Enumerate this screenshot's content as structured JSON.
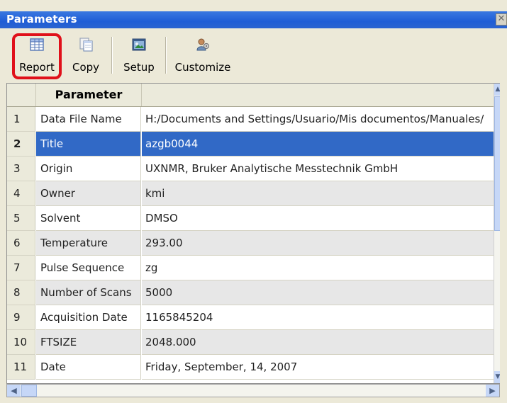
{
  "window": {
    "title": "Parameters",
    "close_glyph": "✕"
  },
  "toolbar": {
    "buttons": [
      {
        "label": "Report",
        "icon": "table-icon"
      },
      {
        "label": "Copy",
        "icon": "copy-icon"
      },
      {
        "label": "Setup",
        "icon": "setup-icon"
      },
      {
        "label": "Customize",
        "icon": "customize-icon"
      }
    ]
  },
  "table": {
    "header": {
      "parameter": "Parameter",
      "value": ""
    },
    "rows": [
      {
        "num": "1",
        "name": "Data File Name",
        "value": "H:/Documents and Settings/Usuario/Mis documentos/Manuales/"
      },
      {
        "num": "2",
        "name": "Title",
        "value": "azgb0044"
      },
      {
        "num": "3",
        "name": "Origin",
        "value": "UXNMR, Bruker Analytische Messtechnik GmbH"
      },
      {
        "num": "4",
        "name": "Owner",
        "value": "kmi"
      },
      {
        "num": "5",
        "name": "Solvent",
        "value": "DMSO"
      },
      {
        "num": "6",
        "name": "Temperature",
        "value": "293.00"
      },
      {
        "num": "7",
        "name": "Pulse Sequence",
        "value": "zg"
      },
      {
        "num": "8",
        "name": "Number of Scans",
        "value": "5000"
      },
      {
        "num": "9",
        "name": "Acquisition Date",
        "value": "1165845204"
      },
      {
        "num": "10",
        "name": "FTSIZE",
        "value": "2048.000"
      },
      {
        "num": "11",
        "name": "Date",
        "value": "Friday, September, 14, 2007"
      }
    ],
    "selected_row": "2"
  },
  "scrollbars": {
    "up": "▲",
    "down": "▼",
    "left": "◀",
    "right": "▶"
  },
  "colors": {
    "selection": "#3169c6",
    "titlebar": "#2a63d0",
    "highlight": "#e0101a"
  }
}
